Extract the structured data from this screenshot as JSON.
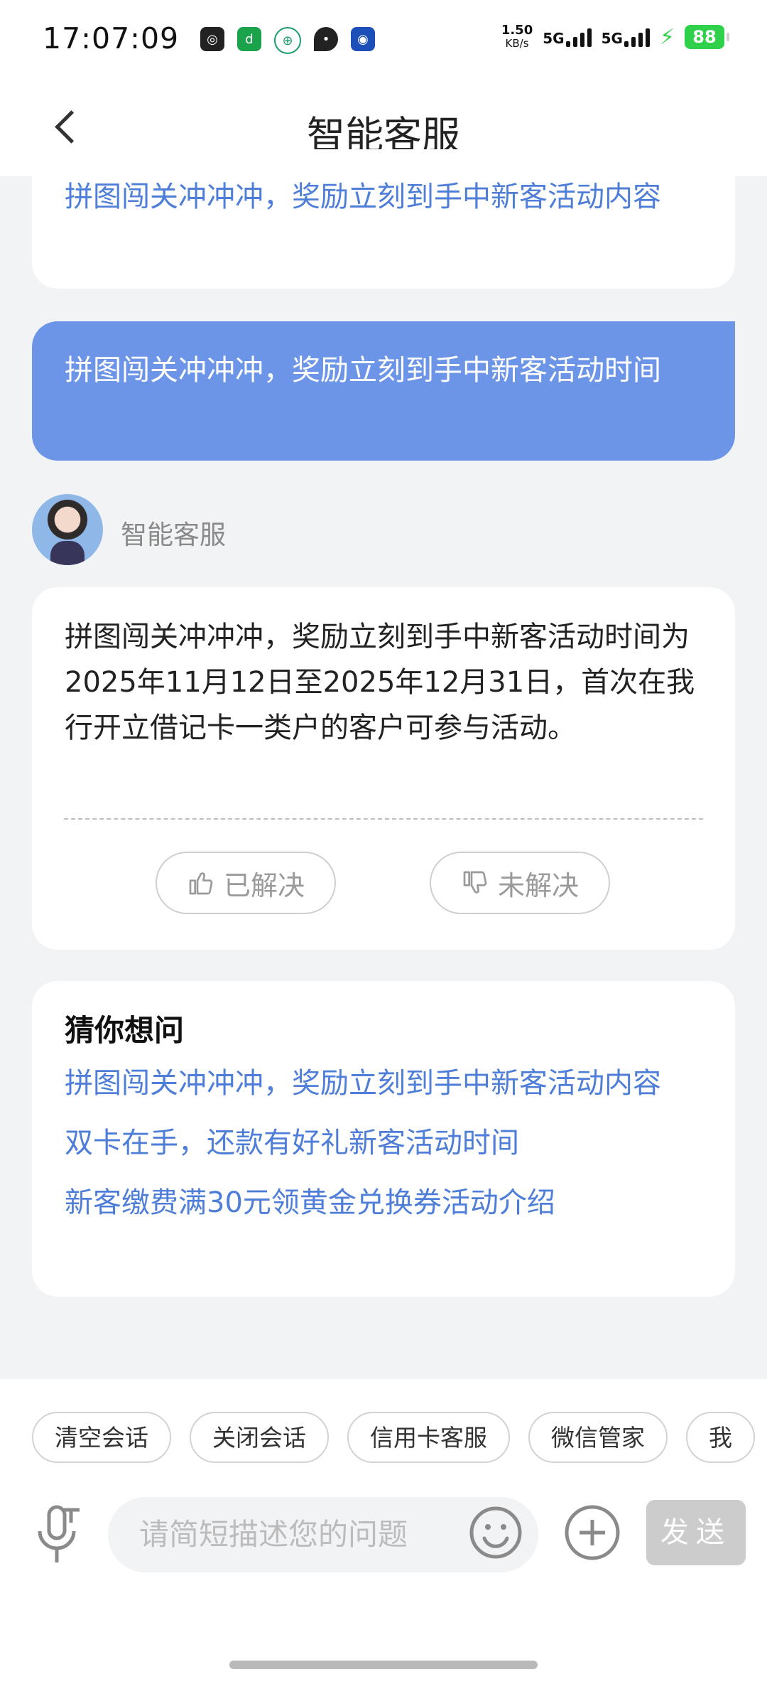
{
  "status_bar": {
    "time": "17:07:09",
    "net_speed_value": "1.50",
    "net_speed_unit": "KB/s",
    "signal_1": "5G",
    "signal_2": "5G",
    "battery": "88"
  },
  "header": {
    "title": "智能客服"
  },
  "prev_card": {
    "link": "拼图闯关冲冲冲，奖励立刻到手中新客活动内容"
  },
  "user_message": {
    "text": "拼图闯关冲冲冲，奖励立刻到手中新客活动时间"
  },
  "agent": {
    "name": "智能客服"
  },
  "answer": {
    "text": "拼图闯关冲冲冲，奖励立刻到手中新客活动时间为2025年11月12日至2025年12月31日，首次在我行开立借记卡一类户的客户可参与活动。",
    "resolved_label": "已解决",
    "unresolved_label": "未解决"
  },
  "suggestions": {
    "title": "猜你想问",
    "items": [
      "拼图闯关冲冲冲，奖励立刻到手中新客活动内容",
      "双卡在手，还款有好礼新客活动时间",
      "新客缴费满30元领黄金兑换券活动介绍"
    ]
  },
  "quick_actions": [
    "清空会话",
    "关闭会话",
    "信用卡客服",
    "微信管家",
    "我"
  ],
  "composer": {
    "placeholder": "请简短描述您的问题",
    "send_label": "发送"
  },
  "colors": {
    "accent": "#4f7ed9",
    "user_bubble": "#6c95e8",
    "background": "#f2f3f5"
  }
}
